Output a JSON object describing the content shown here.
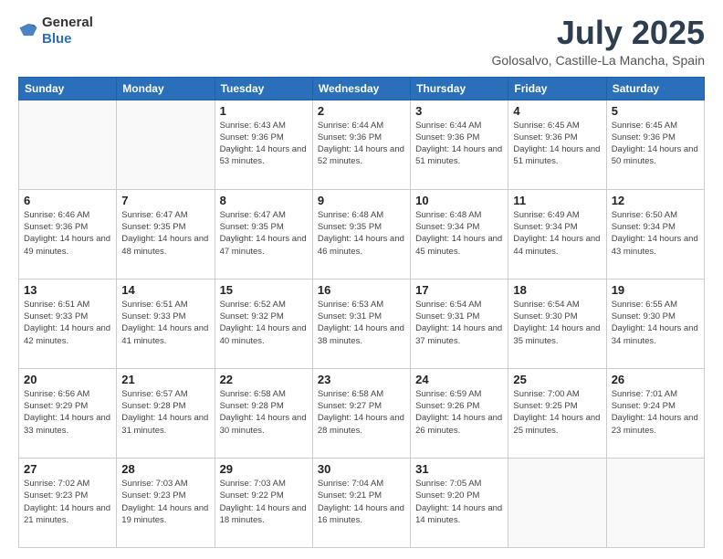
{
  "header": {
    "logo_general": "General",
    "logo_blue": "Blue",
    "month": "July 2025",
    "location": "Golosalvo, Castille-La Mancha, Spain"
  },
  "weekdays": [
    "Sunday",
    "Monday",
    "Tuesday",
    "Wednesday",
    "Thursday",
    "Friday",
    "Saturday"
  ],
  "weeks": [
    [
      {
        "day": "",
        "info": ""
      },
      {
        "day": "",
        "info": ""
      },
      {
        "day": "1",
        "info": "Sunrise: 6:43 AM\nSunset: 9:36 PM\nDaylight: 14 hours and 53 minutes."
      },
      {
        "day": "2",
        "info": "Sunrise: 6:44 AM\nSunset: 9:36 PM\nDaylight: 14 hours and 52 minutes."
      },
      {
        "day": "3",
        "info": "Sunrise: 6:44 AM\nSunset: 9:36 PM\nDaylight: 14 hours and 51 minutes."
      },
      {
        "day": "4",
        "info": "Sunrise: 6:45 AM\nSunset: 9:36 PM\nDaylight: 14 hours and 51 minutes."
      },
      {
        "day": "5",
        "info": "Sunrise: 6:45 AM\nSunset: 9:36 PM\nDaylight: 14 hours and 50 minutes."
      }
    ],
    [
      {
        "day": "6",
        "info": "Sunrise: 6:46 AM\nSunset: 9:36 PM\nDaylight: 14 hours and 49 minutes."
      },
      {
        "day": "7",
        "info": "Sunrise: 6:47 AM\nSunset: 9:35 PM\nDaylight: 14 hours and 48 minutes."
      },
      {
        "day": "8",
        "info": "Sunrise: 6:47 AM\nSunset: 9:35 PM\nDaylight: 14 hours and 47 minutes."
      },
      {
        "day": "9",
        "info": "Sunrise: 6:48 AM\nSunset: 9:35 PM\nDaylight: 14 hours and 46 minutes."
      },
      {
        "day": "10",
        "info": "Sunrise: 6:48 AM\nSunset: 9:34 PM\nDaylight: 14 hours and 45 minutes."
      },
      {
        "day": "11",
        "info": "Sunrise: 6:49 AM\nSunset: 9:34 PM\nDaylight: 14 hours and 44 minutes."
      },
      {
        "day": "12",
        "info": "Sunrise: 6:50 AM\nSunset: 9:34 PM\nDaylight: 14 hours and 43 minutes."
      }
    ],
    [
      {
        "day": "13",
        "info": "Sunrise: 6:51 AM\nSunset: 9:33 PM\nDaylight: 14 hours and 42 minutes."
      },
      {
        "day": "14",
        "info": "Sunrise: 6:51 AM\nSunset: 9:33 PM\nDaylight: 14 hours and 41 minutes."
      },
      {
        "day": "15",
        "info": "Sunrise: 6:52 AM\nSunset: 9:32 PM\nDaylight: 14 hours and 40 minutes."
      },
      {
        "day": "16",
        "info": "Sunrise: 6:53 AM\nSunset: 9:31 PM\nDaylight: 14 hours and 38 minutes."
      },
      {
        "day": "17",
        "info": "Sunrise: 6:54 AM\nSunset: 9:31 PM\nDaylight: 14 hours and 37 minutes."
      },
      {
        "day": "18",
        "info": "Sunrise: 6:54 AM\nSunset: 9:30 PM\nDaylight: 14 hours and 35 minutes."
      },
      {
        "day": "19",
        "info": "Sunrise: 6:55 AM\nSunset: 9:30 PM\nDaylight: 14 hours and 34 minutes."
      }
    ],
    [
      {
        "day": "20",
        "info": "Sunrise: 6:56 AM\nSunset: 9:29 PM\nDaylight: 14 hours and 33 minutes."
      },
      {
        "day": "21",
        "info": "Sunrise: 6:57 AM\nSunset: 9:28 PM\nDaylight: 14 hours and 31 minutes."
      },
      {
        "day": "22",
        "info": "Sunrise: 6:58 AM\nSunset: 9:28 PM\nDaylight: 14 hours and 30 minutes."
      },
      {
        "day": "23",
        "info": "Sunrise: 6:58 AM\nSunset: 9:27 PM\nDaylight: 14 hours and 28 minutes."
      },
      {
        "day": "24",
        "info": "Sunrise: 6:59 AM\nSunset: 9:26 PM\nDaylight: 14 hours and 26 minutes."
      },
      {
        "day": "25",
        "info": "Sunrise: 7:00 AM\nSunset: 9:25 PM\nDaylight: 14 hours and 25 minutes."
      },
      {
        "day": "26",
        "info": "Sunrise: 7:01 AM\nSunset: 9:24 PM\nDaylight: 14 hours and 23 minutes."
      }
    ],
    [
      {
        "day": "27",
        "info": "Sunrise: 7:02 AM\nSunset: 9:23 PM\nDaylight: 14 hours and 21 minutes."
      },
      {
        "day": "28",
        "info": "Sunrise: 7:03 AM\nSunset: 9:23 PM\nDaylight: 14 hours and 19 minutes."
      },
      {
        "day": "29",
        "info": "Sunrise: 7:03 AM\nSunset: 9:22 PM\nDaylight: 14 hours and 18 minutes."
      },
      {
        "day": "30",
        "info": "Sunrise: 7:04 AM\nSunset: 9:21 PM\nDaylight: 14 hours and 16 minutes."
      },
      {
        "day": "31",
        "info": "Sunrise: 7:05 AM\nSunset: 9:20 PM\nDaylight: 14 hours and 14 minutes."
      },
      {
        "day": "",
        "info": ""
      },
      {
        "day": "",
        "info": ""
      }
    ]
  ]
}
